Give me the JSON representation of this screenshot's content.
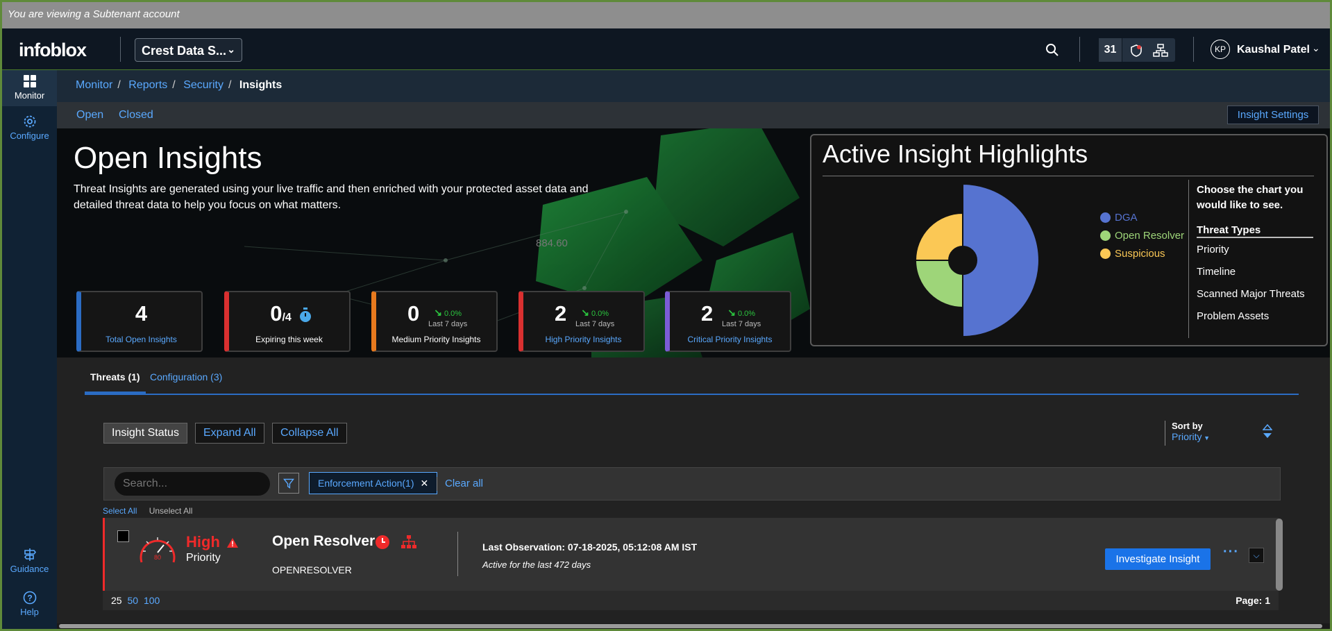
{
  "banner": "You are viewing a Subtenant account",
  "header": {
    "logo": "infoblox",
    "tenant": "Crest Data S...",
    "notification_count": "31",
    "user_initials": "KP",
    "user_name": "Kaushal Patel"
  },
  "sidebar": {
    "monitor": "Monitor",
    "configure": "Configure",
    "guidance": "Guidance",
    "help": "Help"
  },
  "breadcrumb": [
    "Monitor",
    "Reports",
    "Security",
    "Insights"
  ],
  "subnav": {
    "open": "Open",
    "closed": "Closed",
    "settings": "Insight Settings"
  },
  "hero": {
    "title": "Open Insights",
    "description": "Threat Insights are generated using your live traffic and then enriched with your protected asset data and detailed threat data to help you focus on what matters."
  },
  "kpis": [
    {
      "value": "4",
      "label": "Total Open Insights",
      "color": "#2b6cc4"
    },
    {
      "value": "0",
      "total": "/4",
      "label": "Expiring this week",
      "color": "#d93030"
    },
    {
      "value": "0",
      "trend": "0.0%",
      "days": "Last 7 days",
      "label": "Medium Priority Insights",
      "color": "#e87a1e"
    },
    {
      "value": "2",
      "trend": "0.0%",
      "days": "Last 7 days",
      "label": "High Priority Insights",
      "color": "#d93030"
    },
    {
      "value": "2",
      "trend": "0.0%",
      "days": "Last 7 days",
      "label": "Critical Priority Insights",
      "color": "#7b5cd6"
    }
  ],
  "highlights": {
    "title": "Active Insight Highlights",
    "legend": [
      {
        "name": "DGA",
        "color": "#5673d0"
      },
      {
        "name": "Open Resolver",
        "color": "#9ed579"
      },
      {
        "name": "Suspicious",
        "color": "#fbc855"
      }
    ],
    "chooser_heading": "Choose the chart you would like to see.",
    "chooser_items": [
      "Threat Types",
      "Priority",
      "Timeline",
      "Scanned Major Threats",
      "Problem Assets"
    ]
  },
  "chart_data": {
    "type": "pie",
    "categories": [
      "DGA",
      "Open Resolver",
      "Suspicious"
    ],
    "values": [
      2,
      1,
      1
    ],
    "colors": [
      "#5673d0",
      "#9ed579",
      "#fbc855"
    ]
  },
  "tabs": {
    "threats": "Threats (1)",
    "configuration": "Configuration (3)"
  },
  "actions": {
    "status": "Insight Status",
    "expand": "Expand All",
    "collapse": "Collapse All"
  },
  "sort": {
    "label": "Sort by",
    "value": "Priority"
  },
  "filters": {
    "search_placeholder": "Search...",
    "chip": "Enforcement Action(1)",
    "clear_all": "Clear all"
  },
  "selection": {
    "select_all": "Select All",
    "unselect_all": "Unselect All"
  },
  "insight": {
    "severity": "High",
    "severity_sub": "Priority",
    "gauge_value": "80",
    "title": "Open Resolver",
    "subtitle": "OPENRESOLVER",
    "last_observation": "Last Observation: 07-18-2025, 05:12:08 AM IST",
    "active_for": "Active for the last 472 days",
    "investigate": "Investigate Insight"
  },
  "pager": {
    "sizes": [
      "25",
      "50",
      "100"
    ],
    "page": "Page: 1"
  }
}
